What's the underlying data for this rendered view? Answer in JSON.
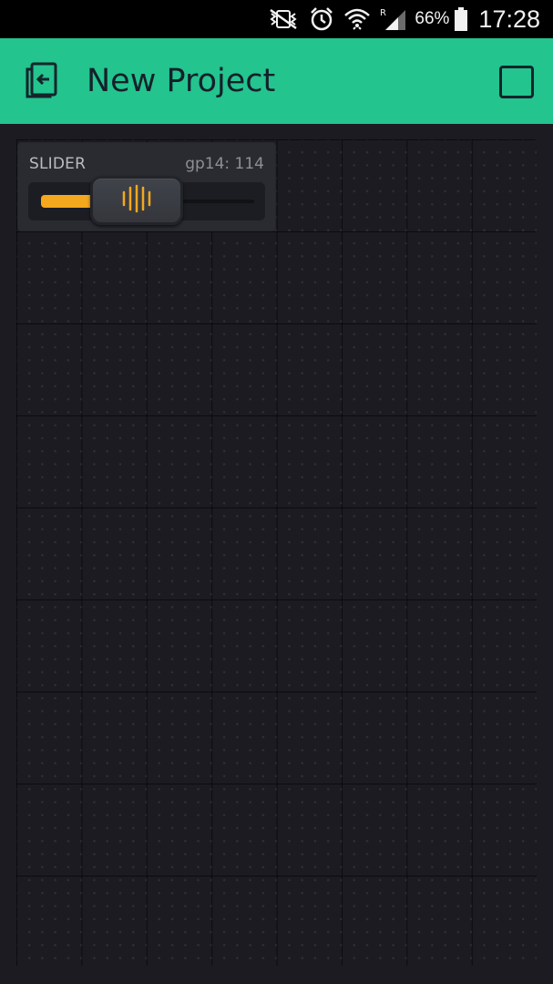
{
  "status_bar": {
    "battery_percent": "66%",
    "time": "17:28",
    "icons": [
      "mute-vibrate-icon",
      "alarm-icon",
      "wifi-icon",
      "signal-roaming-icon",
      "battery-icon"
    ]
  },
  "app_bar": {
    "title": "New Project",
    "back_icon": "exit-project-icon",
    "play_icon": "play-stop-square-icon",
    "background": "#23c48e"
  },
  "slider_widget": {
    "label": "SLIDER",
    "pin": "gp14",
    "value_text": "gp14: 114",
    "value": 114,
    "min": 0,
    "max": 255,
    "accent": "#f4a81d"
  }
}
